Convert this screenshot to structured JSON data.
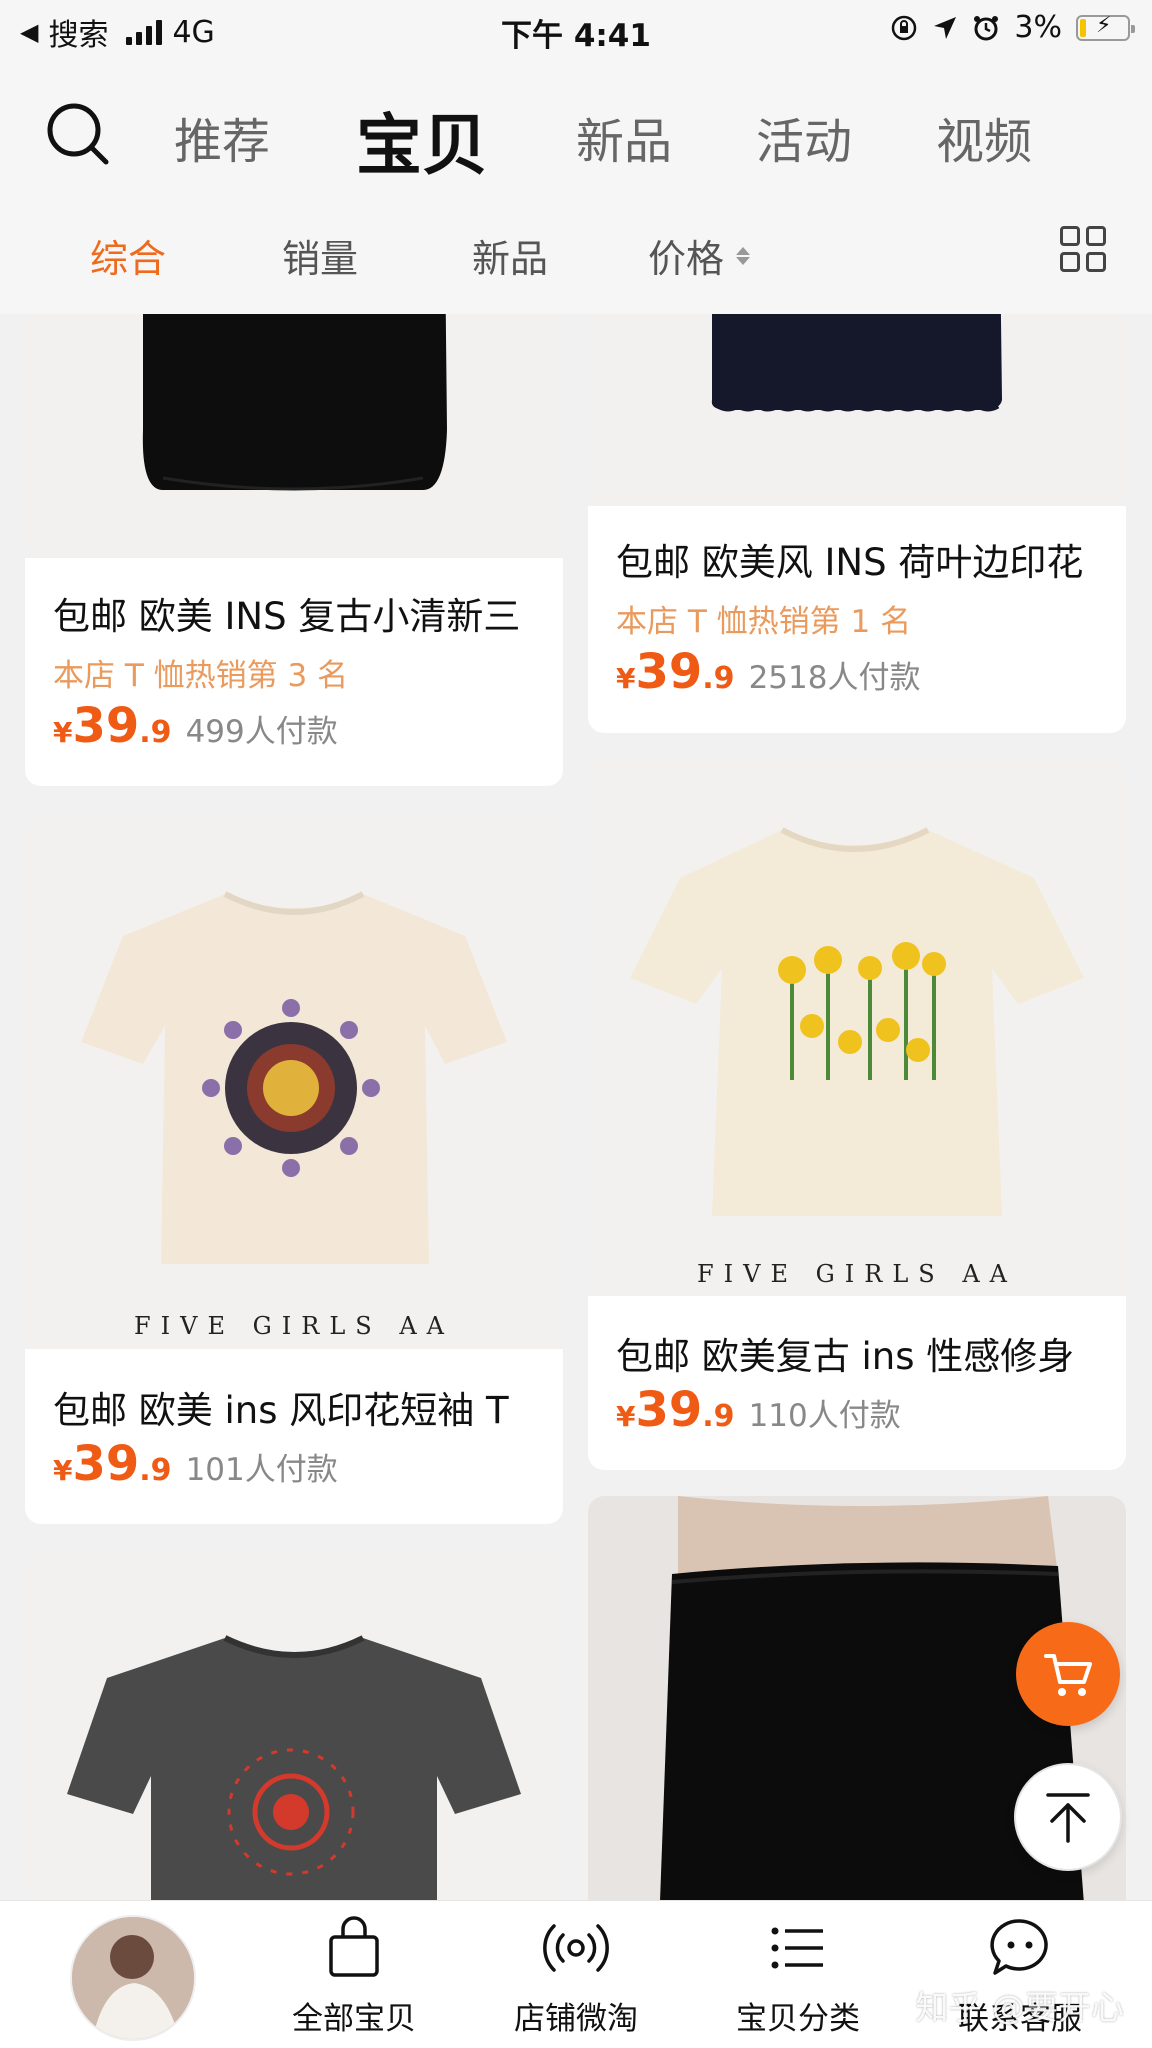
{
  "status_bar": {
    "back_label": "搜索",
    "network": "4G",
    "time": "下午 4:41",
    "battery": "3%"
  },
  "top_nav": {
    "tabs": [
      {
        "label": "推荐",
        "active": false
      },
      {
        "label": "宝贝",
        "active": true
      },
      {
        "label": "新品",
        "active": false
      },
      {
        "label": "活动",
        "active": false
      },
      {
        "label": "视频",
        "active": false
      }
    ]
  },
  "sort_bar": {
    "items": [
      {
        "label": "综合",
        "active": true
      },
      {
        "label": "销量",
        "active": false
      },
      {
        "label": "新品",
        "active": false
      },
      {
        "label": "价格",
        "active": false
      }
    ]
  },
  "products": [
    {
      "title": "包邮 欧美 INS 复古小清新三",
      "rank": "本店 T 恤热销第 3 名",
      "price_currency": "¥",
      "price_int": "39",
      "price_dec": ".9",
      "sales": "499人付款"
    },
    {
      "title": "包邮 欧美风 INS 荷叶边印花",
      "rank": "本店 T 恤热销第 1 名",
      "price_currency": "¥",
      "price_int": "39",
      "price_dec": ".9",
      "sales": "2518人付款"
    },
    {
      "title": "包邮 欧美 ins 风印花短袖 T",
      "brand_caption": "FIVE GIRLS AA",
      "price_currency": "¥",
      "price_int": "39",
      "price_dec": ".9",
      "sales": "101人付款"
    },
    {
      "title": "包邮 欧美复古 ins 性感修身",
      "brand_caption": "FIVE GIRLS AA",
      "price_currency": "¥",
      "price_int": "39",
      "price_dec": ".9",
      "sales": "110人付款"
    }
  ],
  "bottom_bar": {
    "tabs": [
      {
        "label": "全部宝贝",
        "icon": "shopping-bag-icon"
      },
      {
        "label": "店铺微淘",
        "icon": "broadcast-icon"
      },
      {
        "label": "宝贝分类",
        "icon": "list-icon"
      },
      {
        "label": "联系客服",
        "icon": "chat-icon"
      }
    ]
  },
  "watermark": "知乎 @要开心",
  "colors": {
    "accent": "#ef6a1c",
    "price": "#ef5a14",
    "rank_text": "#e99a5c",
    "cart_fab": "#f66a18"
  }
}
